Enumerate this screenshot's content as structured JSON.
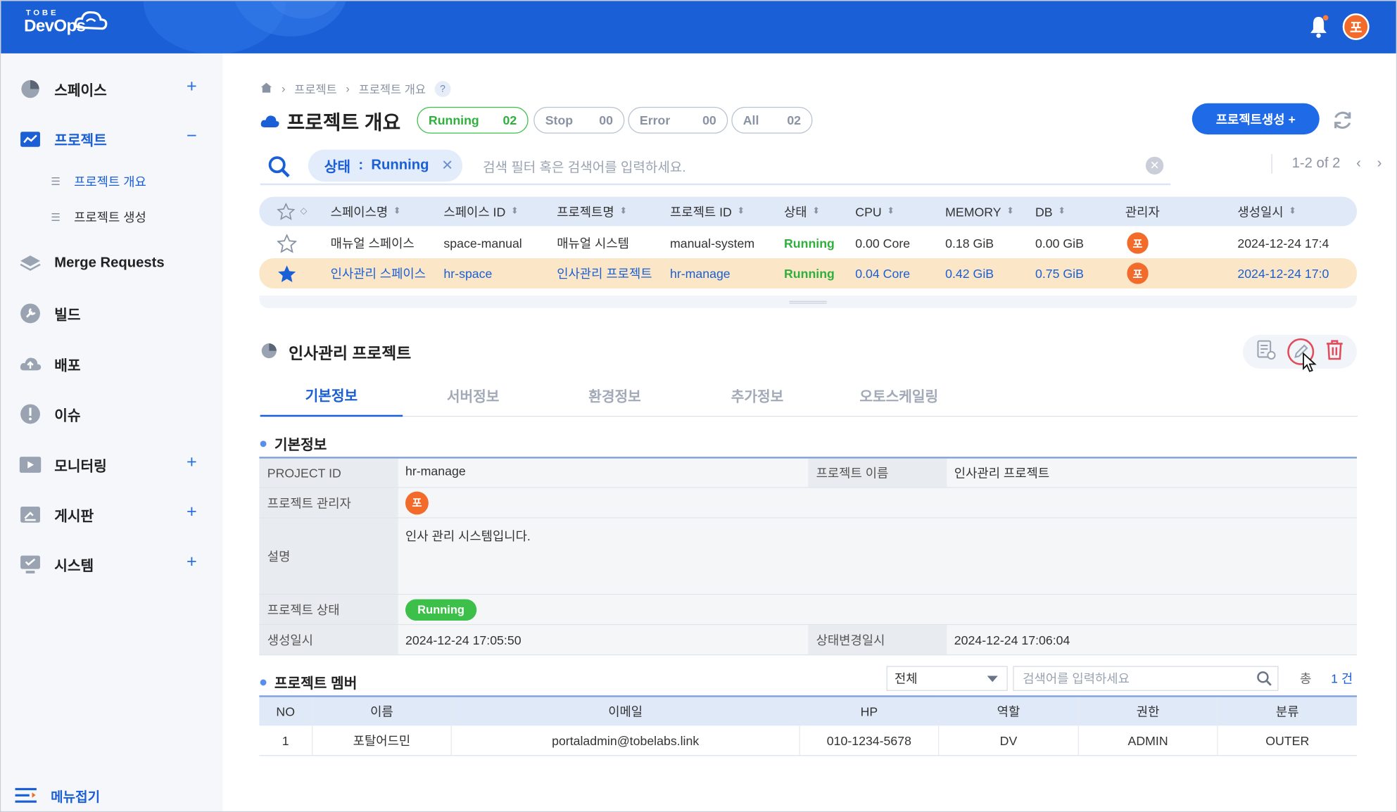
{
  "app": {
    "logo_top": "TOBE",
    "logo_main": "DevOps",
    "user_initial": "포"
  },
  "sidebar": {
    "items": [
      {
        "label": "스페이스",
        "icon": "pie-chart-icon",
        "has_plus": true
      },
      {
        "label": "프로젝트",
        "icon": "project-chart-icon",
        "active": true,
        "expanded": true
      },
      {
        "label": "Merge Requests",
        "icon": "layers-icon"
      },
      {
        "label": "빌드",
        "icon": "wrench-icon"
      },
      {
        "label": "배포",
        "icon": "cloud-upload-icon"
      },
      {
        "label": "이슈",
        "icon": "alert-icon"
      },
      {
        "label": "모니터링",
        "icon": "monitor-icon",
        "has_plus": true
      },
      {
        "label": "게시판",
        "icon": "board-icon",
        "has_plus": true
      },
      {
        "label": "시스템",
        "icon": "system-icon",
        "has_plus": true
      }
    ],
    "sub_items": [
      {
        "label": "프로젝트 개요",
        "active": true
      },
      {
        "label": "프로젝트 생성"
      }
    ],
    "collapse_label": "메뉴접기"
  },
  "breadcrumb": [
    "프로젝트",
    "프로젝트 개요"
  ],
  "page": {
    "title": "프로젝트 개요",
    "create_button": "프로젝트생성 +"
  },
  "status_pills": [
    {
      "label": "Running",
      "count": "02"
    },
    {
      "label": "Stop",
      "count": "00"
    },
    {
      "label": "Error",
      "count": "00"
    },
    {
      "label": "All",
      "count": "02"
    }
  ],
  "search": {
    "filter_key": "상태",
    "filter_sep": ":",
    "filter_value": "Running",
    "placeholder": "검색 필터 혹은 검색어를 입력하세요.",
    "pagination": "1-2 of 2"
  },
  "project_table": {
    "headers": [
      "스페이스명",
      "스페이스 ID",
      "프로젝트명",
      "프로젝트 ID",
      "상태",
      "CPU",
      "MEMORY",
      "DB",
      "관리자",
      "생성일시"
    ],
    "rows": [
      {
        "starred": false,
        "space_name": "매뉴얼 스페이스",
        "space_id": "space-manual",
        "project_name": "매뉴얼 시스템",
        "project_id": "manual-system",
        "status": "Running",
        "cpu": "0.00 Core",
        "memory": "0.18 GiB",
        "db": "0.00 GiB",
        "admin": "포",
        "created": "2024-12-24 17:4"
      },
      {
        "starred": true,
        "selected": true,
        "space_name": "인사관리 스페이스",
        "space_id": "hr-space",
        "project_name": "인사관리 프로젝트",
        "project_id": "hr-manage",
        "status": "Running",
        "cpu": "0.04 Core",
        "memory": "0.42 GiB",
        "db": "0.75 GiB",
        "admin": "포",
        "created": "2024-12-24 17:0"
      }
    ]
  },
  "detail": {
    "title": "인사관리 프로젝트",
    "tabs": [
      "기본정보",
      "서버정보",
      "환경정보",
      "추가정보",
      "오토스케일링"
    ],
    "section_basic": "기본정보",
    "fields": {
      "project_id_label": "PROJECT ID",
      "project_id": "hr-manage",
      "project_name_label": "프로젝트 이름",
      "project_name": "인사관리 프로젝트",
      "manager_label": "프로젝트 관리자",
      "manager": "포",
      "desc_label": "설명",
      "desc": "인사 관리 시스템입니다.",
      "status_label": "프로젝트 상태",
      "status": "Running",
      "created_label": "생성일시",
      "created": "2024-12-24 17:05:50",
      "status_changed_label": "상태변경일시",
      "status_changed": "2024-12-24 17:06:04"
    }
  },
  "members": {
    "title": "프로젝트 멤버",
    "filter_value": "전체",
    "search_placeholder": "검색어를 입력하세요",
    "total_label": "총",
    "total_count": "1 건",
    "headers": [
      "NO",
      "이름",
      "이메일",
      "HP",
      "역할",
      "권한",
      "분류"
    ],
    "rows": [
      [
        "1",
        "포탈어드민",
        "portaladmin@tobelabs.link",
        "010-1234-5678",
        "DV",
        "ADMIN",
        "OUTER"
      ]
    ]
  },
  "colors": {
    "brand_blue": "#1a5fd6",
    "running_green": "#3cc04a",
    "avatar_orange": "#f26b2b",
    "selected_row": "#fbe7c7",
    "delete_red": "#e14b5a"
  }
}
